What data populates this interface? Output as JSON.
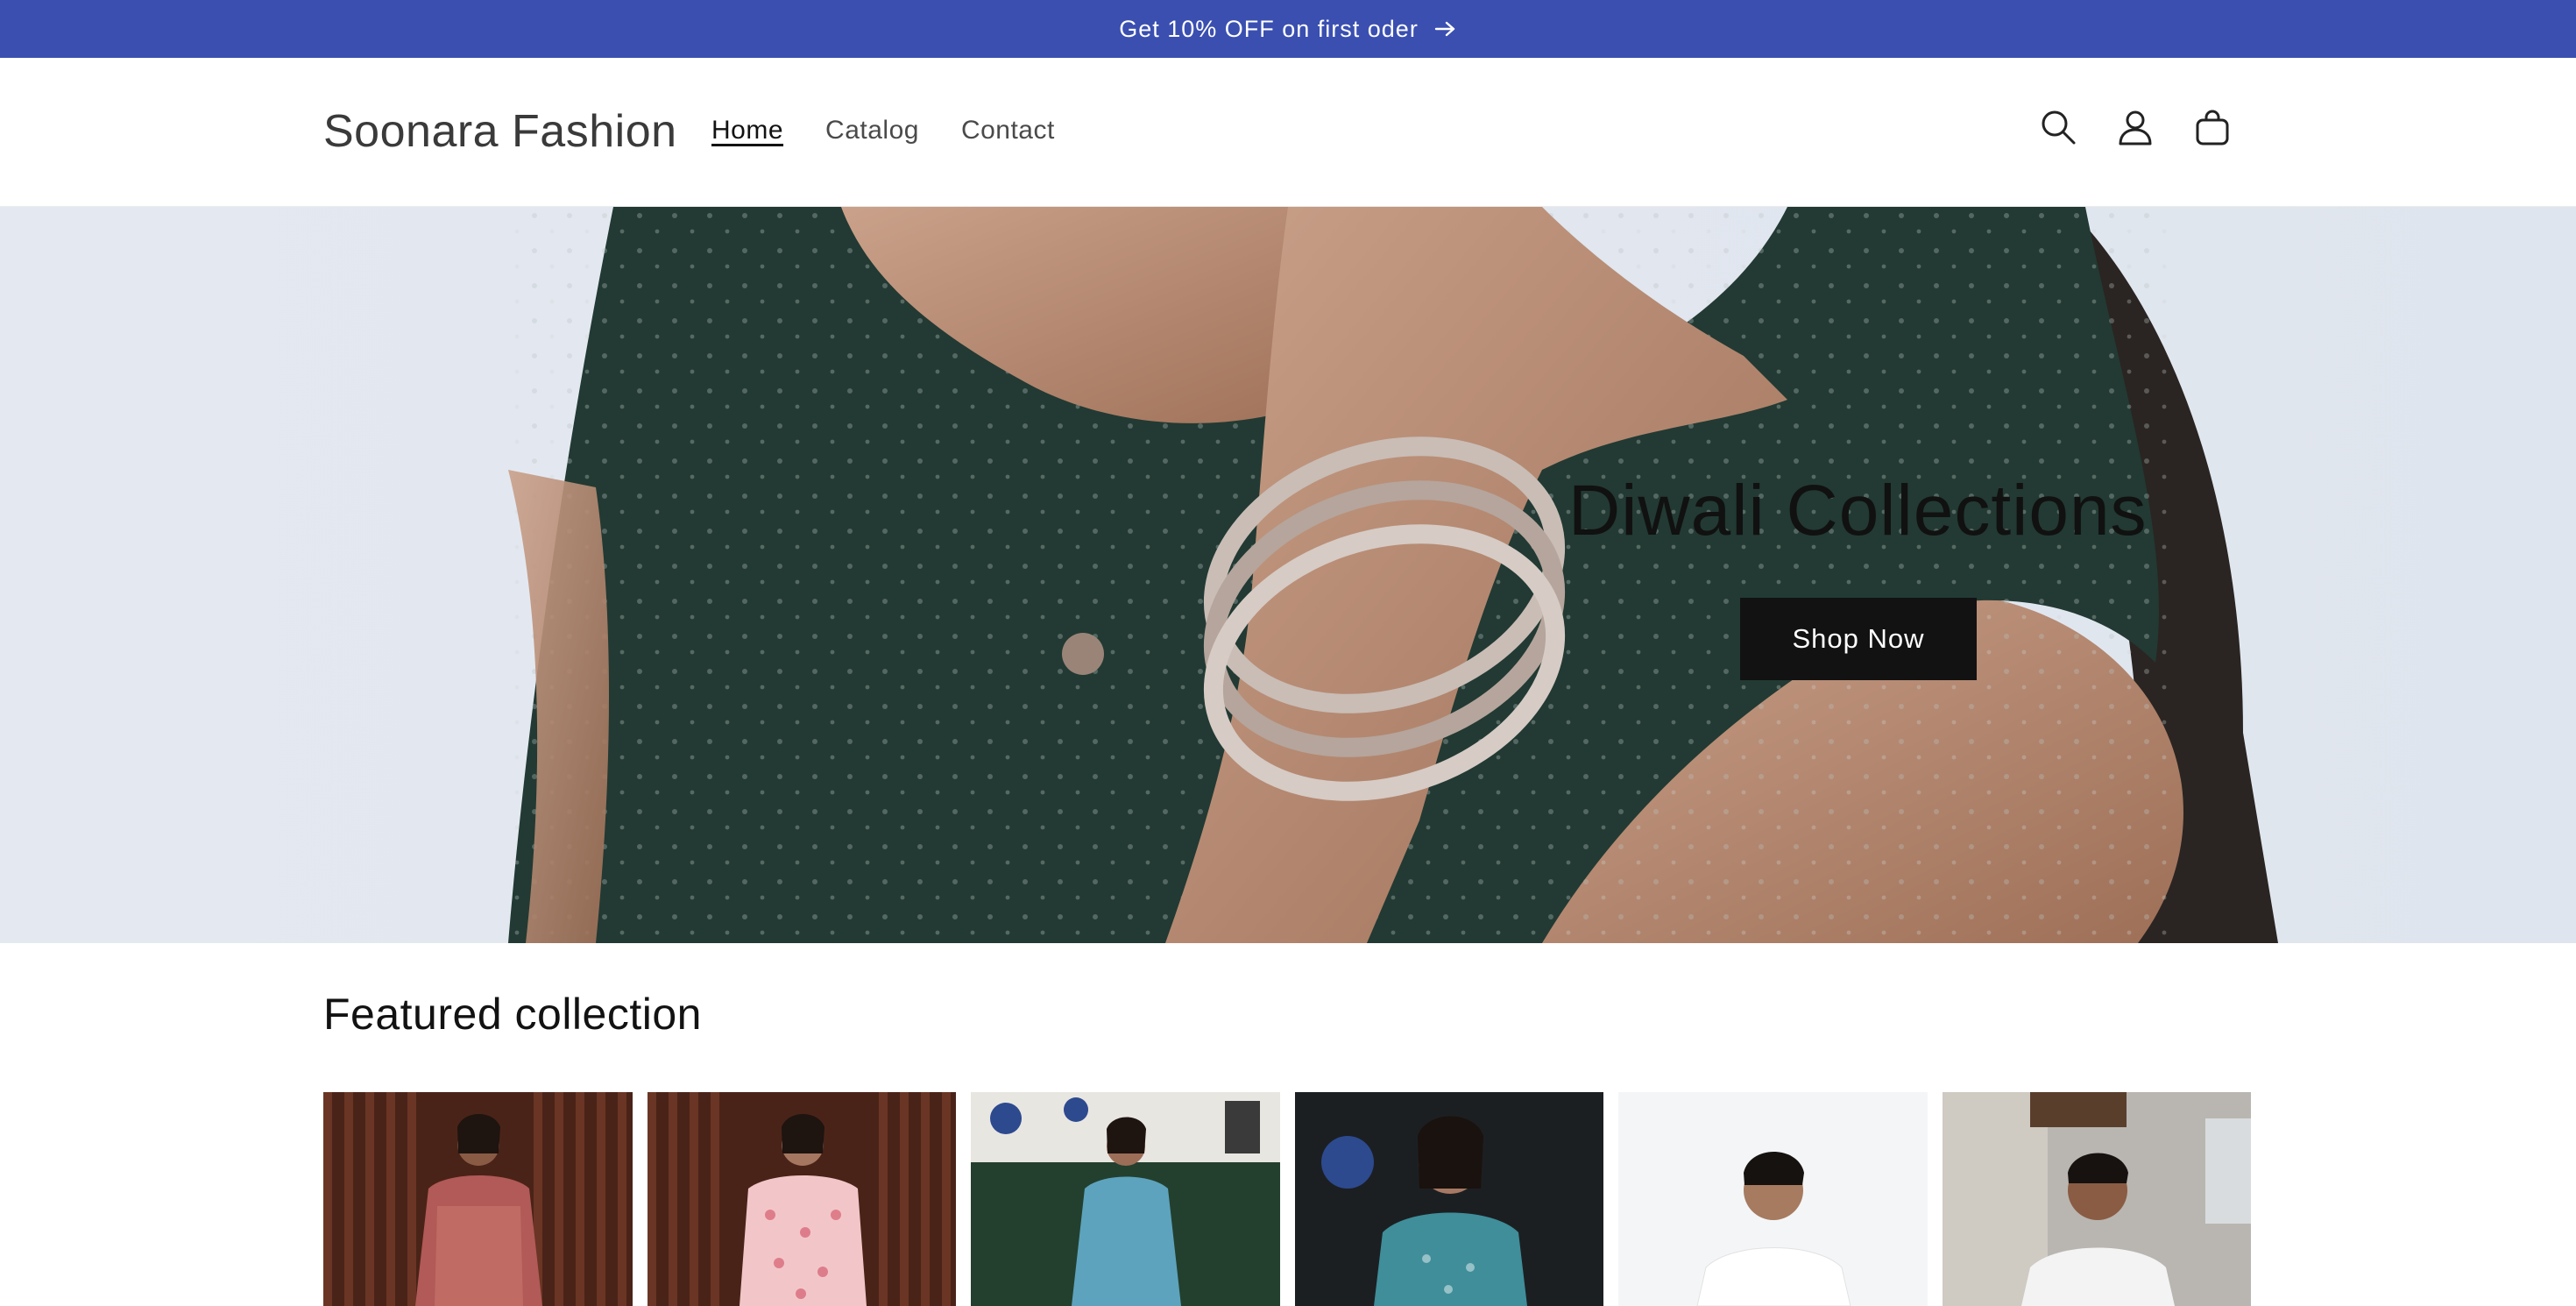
{
  "announcement": {
    "text": "Get 10% OFF on first oder"
  },
  "header": {
    "logo": "Soonara Fashion",
    "nav": [
      {
        "label": "Home",
        "active": true
      },
      {
        "label": "Catalog",
        "active": false
      },
      {
        "label": "Contact",
        "active": false
      }
    ],
    "icons": [
      "search-icon",
      "account-icon",
      "cart-icon"
    ]
  },
  "hero": {
    "title": "Diwali Collections",
    "button_label": "Shop Now"
  },
  "featured": {
    "title": "Featured collection",
    "products": [
      {
        "image": "product-image-floral-kurta-red"
      },
      {
        "image": "product-image-pink-floral-kurta"
      },
      {
        "image": "product-image-blue-sleeveless-kurta"
      },
      {
        "image": "product-image-teal-printed-kurta"
      },
      {
        "image": "product-image-white-shirt-man"
      },
      {
        "image": "product-image-white-shirt-man-2"
      }
    ]
  },
  "colors": {
    "accent": "#3a4fb0",
    "button": "#121212"
  }
}
